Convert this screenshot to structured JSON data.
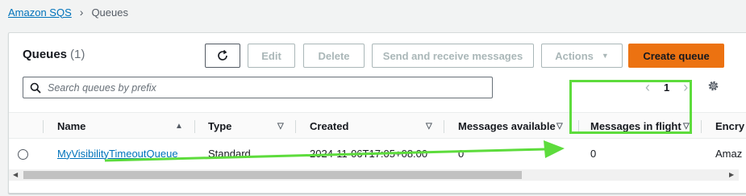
{
  "breadcrumb": {
    "root": "Amazon SQS",
    "current": "Queues"
  },
  "panel": {
    "title": "Queues",
    "count": "(1)",
    "buttons": {
      "refresh_icon": "refresh-icon",
      "edit": "Edit",
      "delete": "Delete",
      "send": "Send and receive messages",
      "actions": "Actions",
      "actions_caret": "▼",
      "create": "Create queue"
    },
    "search": {
      "placeholder": "Search queues by prefix",
      "value": ""
    },
    "pagination": {
      "prev": "‹",
      "page": "1",
      "next": "›"
    }
  },
  "table": {
    "columns": [
      {
        "label": "Name",
        "sort": "▲"
      },
      {
        "label": "Type",
        "sort": "▽"
      },
      {
        "label": "Created",
        "sort": "▽"
      },
      {
        "label": "Messages available",
        "sort": "▽"
      },
      {
        "label": "Messages in flight",
        "sort": "▽"
      },
      {
        "label": "Encry"
      }
    ],
    "rows": [
      {
        "name": "MyVisibilityTimeoutQueue",
        "type": "Standard",
        "created": "2024-11-06T17:05+08:00",
        "messages_available": "0",
        "messages_in_flight": "0",
        "encryption": "Amaz"
      }
    ]
  },
  "scroll": {
    "left": "◀",
    "right": "▶"
  },
  "colors": {
    "accent": "#ec7211",
    "link": "#0073bb",
    "annotation": "#5ddc3c"
  }
}
